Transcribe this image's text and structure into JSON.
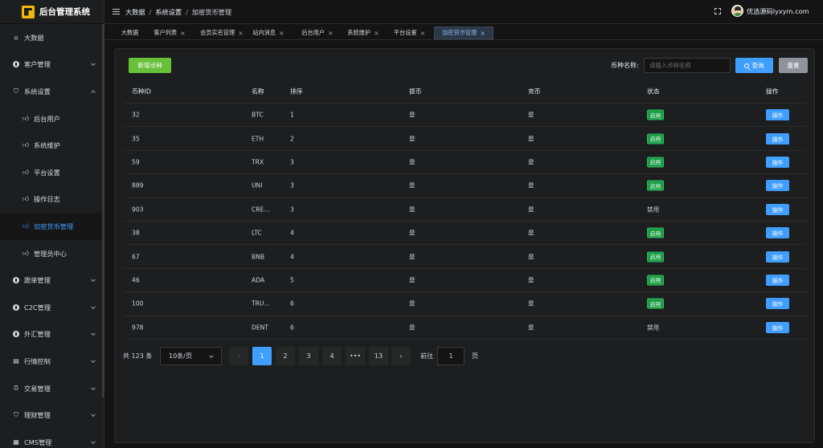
{
  "app": {
    "title": "后台管理系统"
  },
  "sidebar": {
    "items": [
      {
        "label": "大数据",
        "icon": "home-icon",
        "level": 1
      },
      {
        "label": "客户管理",
        "icon": "circle-icon",
        "level": 1,
        "arrow": "down"
      },
      {
        "label": "系统设置",
        "icon": "shield-icon",
        "level": 1,
        "arrow": "up"
      },
      {
        "label": "后台用户",
        "icon": "thumb-icon",
        "level": 2
      },
      {
        "label": "系统维护",
        "icon": "thumb-icon",
        "level": 2
      },
      {
        "label": "平台设置",
        "icon": "thumb-icon",
        "level": 2
      },
      {
        "label": "操作日志",
        "icon": "thumb-icon",
        "level": 2
      },
      {
        "label": "加密货币管理",
        "icon": "thumb-icon",
        "level": 2,
        "active": true
      },
      {
        "label": "管理员中心",
        "icon": "thumb-icon",
        "level": 2
      },
      {
        "label": "跟单管理",
        "icon": "circle-icon",
        "level": 1,
        "arrow": "down"
      },
      {
        "label": "C2C管理",
        "icon": "circle-icon",
        "level": 1,
        "arrow": "down"
      },
      {
        "label": "外汇管理",
        "icon": "circle-icon",
        "level": 1,
        "arrow": "down"
      },
      {
        "label": "行情控制",
        "icon": "calendar-icon",
        "level": 1,
        "arrow": "down"
      },
      {
        "label": "交易管理",
        "icon": "alarm-icon",
        "level": 1,
        "arrow": "down"
      },
      {
        "label": "理财管理",
        "icon": "shield-icon",
        "level": 1,
        "arrow": "down"
      },
      {
        "label": "CMS管理",
        "icon": "document-icon",
        "level": 1,
        "arrow": "down"
      }
    ]
  },
  "header": {
    "breadcrumb": [
      "大数据",
      "系统设置",
      "加密货币管理"
    ],
    "user": "优选源码lyxym.com"
  },
  "tabs": [
    {
      "label": "大数据",
      "closable": false
    },
    {
      "label": "客户列表",
      "closable": true
    },
    {
      "label": "会员实名管理",
      "closable": true
    },
    {
      "label": "站内消息",
      "closable": true
    },
    {
      "label": "后台用户",
      "closable": true
    },
    {
      "label": "系统维护",
      "closable": true
    },
    {
      "label": "平台设置",
      "closable": true
    },
    {
      "label": "加密货币管理",
      "closable": true,
      "active": true
    }
  ],
  "toolbar": {
    "add_label": "新增币种",
    "search_label": "币种名称:",
    "search_placeholder": "请输入币种名称",
    "query_label": "查询",
    "reset_label": "重置"
  },
  "table": {
    "headers": [
      "币种ID",
      "名称",
      "排序",
      "提币",
      "充币",
      "状态",
      "操作"
    ],
    "rows": [
      {
        "id": "32",
        "name": "BTC",
        "sort": "1",
        "withdraw": "是",
        "deposit": "是",
        "status": "启用",
        "enabled": true
      },
      {
        "id": "35",
        "name": "ETH",
        "sort": "2",
        "withdraw": "是",
        "deposit": "是",
        "status": "启用",
        "enabled": true
      },
      {
        "id": "59",
        "name": "TRX",
        "sort": "3",
        "withdraw": "是",
        "deposit": "是",
        "status": "启用",
        "enabled": true
      },
      {
        "id": "889",
        "name": "UNI",
        "sort": "3",
        "withdraw": "是",
        "deposit": "是",
        "status": "启用",
        "enabled": true
      },
      {
        "id": "903",
        "name": "CRE…",
        "sort": "3",
        "withdraw": "是",
        "deposit": "是",
        "status": "禁用",
        "enabled": false
      },
      {
        "id": "38",
        "name": "LTC",
        "sort": "4",
        "withdraw": "是",
        "deposit": "是",
        "status": "启用",
        "enabled": true
      },
      {
        "id": "67",
        "name": "BNB",
        "sort": "4",
        "withdraw": "是",
        "deposit": "是",
        "status": "启用",
        "enabled": true
      },
      {
        "id": "46",
        "name": "ADA",
        "sort": "5",
        "withdraw": "是",
        "deposit": "是",
        "status": "启用",
        "enabled": true
      },
      {
        "id": "100",
        "name": "TRU…",
        "sort": "6",
        "withdraw": "是",
        "deposit": "是",
        "status": "启用",
        "enabled": true
      },
      {
        "id": "978",
        "name": "DENT",
        "sort": "6",
        "withdraw": "是",
        "deposit": "是",
        "status": "禁用",
        "enabled": false
      }
    ],
    "action_label": "操作"
  },
  "pagination": {
    "total_text": "共 123 条",
    "page_size": "10条/页",
    "prev": "‹",
    "next": "›",
    "pages": [
      "1",
      "2",
      "3",
      "4",
      "•••",
      "13"
    ],
    "current_page": "1",
    "goto_prefix": "前往",
    "goto_value": "1",
    "goto_suffix": "页"
  },
  "colors": {
    "primary": "#409eff",
    "success": "#67c23a",
    "status_on": "#1e9b47",
    "reset": "#909399"
  }
}
